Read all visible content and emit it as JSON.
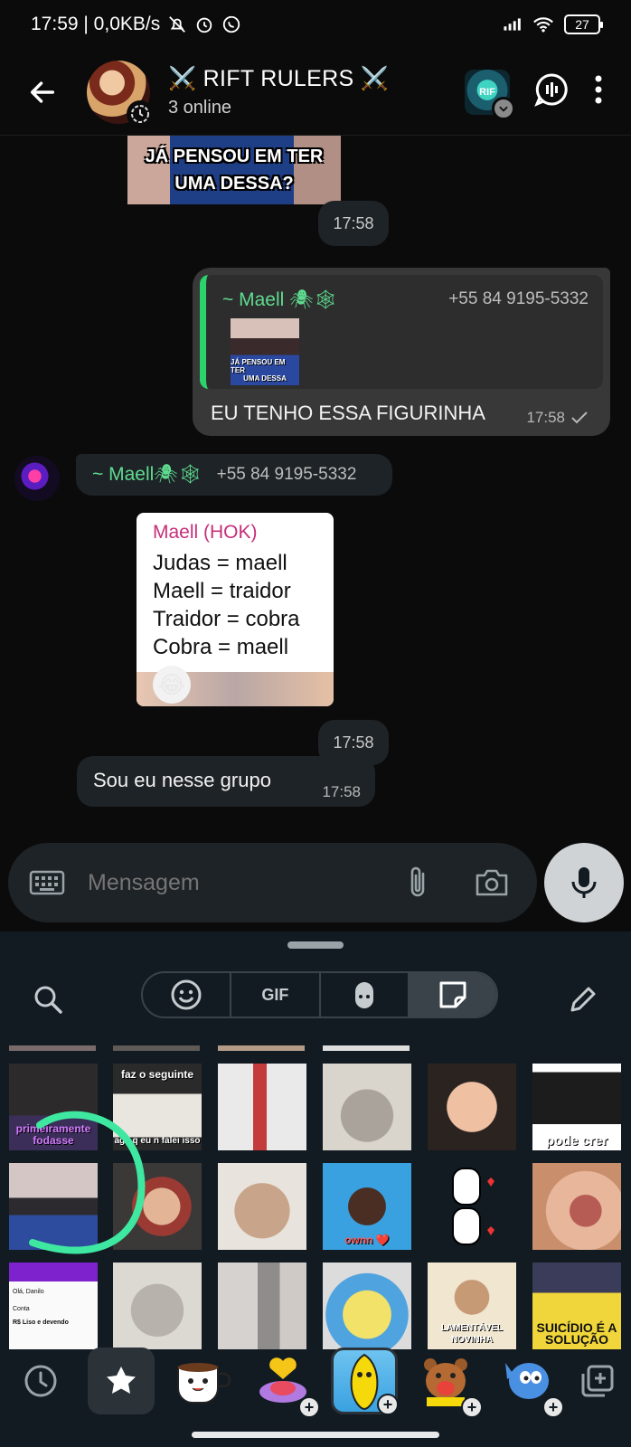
{
  "status_bar": {
    "time_speed": "17:59 | 0,0KB/s",
    "battery": "27"
  },
  "header": {
    "title": "⚔️ RIFT RULERS ⚔️",
    "subtitle": "3 online",
    "group_badge": "RIF"
  },
  "messages": {
    "sticker_top_text": [
      "JÁ PENSOU EM TER",
      "UMA DESSA?"
    ],
    "time_1": "17:58",
    "outgoing": {
      "quote_name": "~ Maell 🕷🕸",
      "quote_phone": "+55 84 9195-5332",
      "quote_thumb_text": [
        "JÁ PENSOU EM TER",
        "UMA DESSA"
      ],
      "text": "EU TENHO ESSA FIGURINHA",
      "time": "17:58"
    },
    "incoming_name": "~ Maell🕷🕸",
    "incoming_phone": "+55 84 9195-5332",
    "card": {
      "title": "Maell (HOK)",
      "lines": [
        "Judas = maell",
        "Maell = traidor",
        "Traidor = cobra",
        "Cobra = maell"
      ],
      "emoji": "😂"
    },
    "time_2": "17:58",
    "incoming_text": "Sou eu nesse grupo",
    "incoming_time": "17:58"
  },
  "composer": {
    "placeholder": "Mensagem"
  },
  "panel": {
    "tabs": [
      "emoji",
      "GIF",
      "avatar",
      "sticker"
    ],
    "gif_label": "GIF",
    "stickers": {
      "s1_caption": "primeiramente fodasse",
      "s2_caption_top": "faz o seguinte",
      "s2_caption_bottom": "age q eu n falei isso",
      "s6_caption": "pode crer",
      "s10_caption": "ownn ❤️",
      "s13_caption_1": "Olá, Danilo",
      "s13_caption_2": "Conta",
      "s13_caption_3": "R$ Liso e devendo",
      "s17_caption": "LAMENTÁVEL NOVINHA",
      "s18_caption": "SUICÍDIO É A SOLUÇÃO"
    }
  },
  "colors": {
    "background": "#0b0b0b",
    "bubble_in": "#1e2327",
    "bubble_out": "#383838",
    "name_green": "#5fdb8f",
    "accent_green": "#2bd46a",
    "panel_bg": "#121b22"
  }
}
